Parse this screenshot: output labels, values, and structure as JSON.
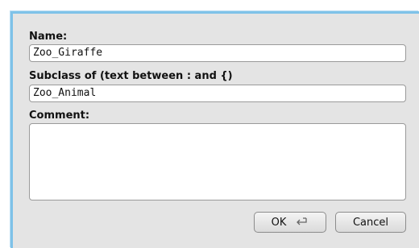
{
  "dialog": {
    "name_label": "Name:",
    "name_value": "Zoo_Giraffe",
    "subclass_label": "Subclass of (text between : and {)",
    "subclass_value": "Zoo_Animal",
    "comment_label": "Comment:",
    "comment_value": "",
    "ok_label": "OK",
    "cancel_label": "Cancel"
  },
  "icons": {
    "enter": "enter-icon"
  },
  "colors": {
    "border_accent": "#7fc2e8",
    "dialog_bg": "#e4e4e4"
  }
}
